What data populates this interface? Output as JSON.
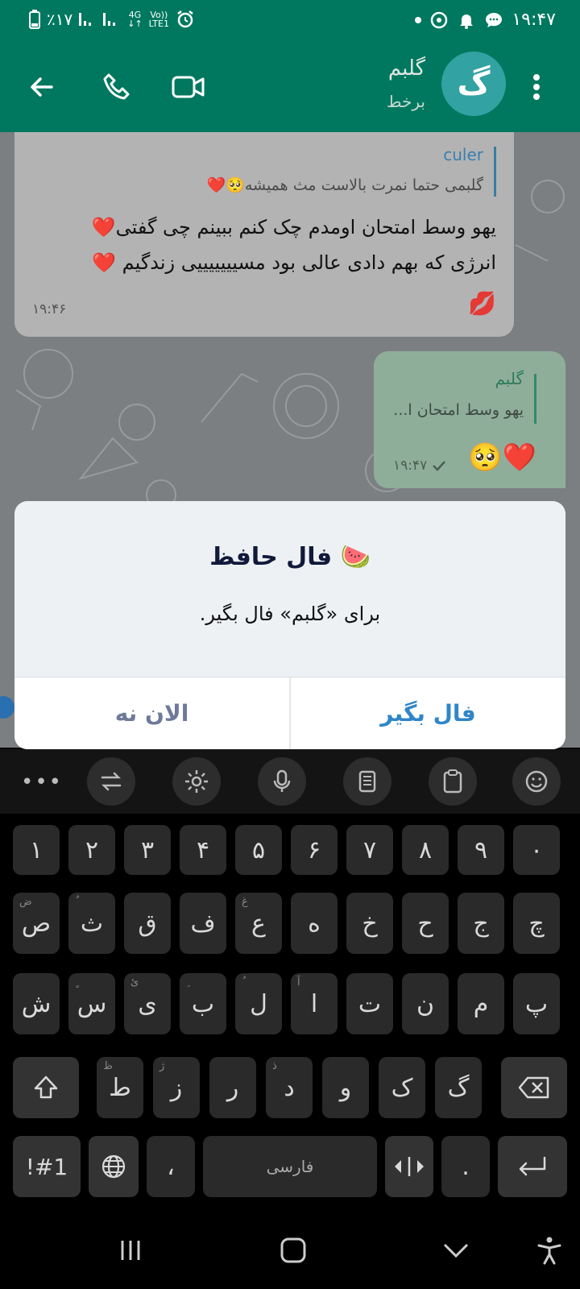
{
  "status_bar": {
    "battery": "٪۱۷",
    "network_top": "4G",
    "volte_top": "Vo))",
    "volte_bottom": "LTE1",
    "time": "۱۹:۴۷"
  },
  "header": {
    "avatar_letter": "گ",
    "name": "گلبم",
    "status": "برخط"
  },
  "messages": {
    "incoming": {
      "reply_author": "culer",
      "reply_text": "گلبمی حتما نمرت بالاست مث همیشه🥺❤️",
      "line1": "یهو وسط امتحان اومدم چک کنم ببینم چی گفتی❤️",
      "line2": "انرژی که بهم دادی عالی بود مسیییییییی زندگیم ❤️",
      "reaction": "💋",
      "time": "۱۹:۴۶"
    },
    "outgoing": {
      "reply_author": "گلبم",
      "reply_text": "یهو وسط امتحان ا...",
      "text": "❤️🥺",
      "time": "۱۹:۴۷"
    }
  },
  "dialog": {
    "title": "🍉 فال حافظ",
    "message": "برای «گلبم» فال بگیر.",
    "confirm_label": "فال بگیر",
    "cancel_label": "الان نه"
  },
  "keyboard": {
    "number_row": [
      "۱",
      "۲",
      "۳",
      "۴",
      "۵",
      "۶",
      "۷",
      "۸",
      "۹",
      "۰"
    ],
    "row1": [
      "ص",
      "ث",
      "ق",
      "ف",
      "ع",
      "ه",
      "خ",
      "ح",
      "ج",
      "چ"
    ],
    "row1_hints": [
      "ض",
      "ٌ",
      "",
      "",
      "غ",
      "",
      "",
      "",
      "",
      ""
    ],
    "row2": [
      "ش",
      "س",
      "ی",
      "ب",
      "ل",
      "ا",
      "ت",
      "ن",
      "م",
      "پ"
    ],
    "row2_hints": [
      "",
      "ٍ",
      "ئ",
      "ِ",
      "ُ",
      "آ",
      "",
      "",
      "",
      ""
    ],
    "row3": [
      "ط",
      "ز",
      "ر",
      "د",
      "و",
      "ک",
      "گ"
    ],
    "row3_hints": [
      "ظ",
      "ژ",
      "",
      "ذ",
      "",
      "",
      ""
    ],
    "symbols_label": "!#1",
    "comma_label": "،",
    "space_label": "فارسی",
    "period_label": "."
  }
}
